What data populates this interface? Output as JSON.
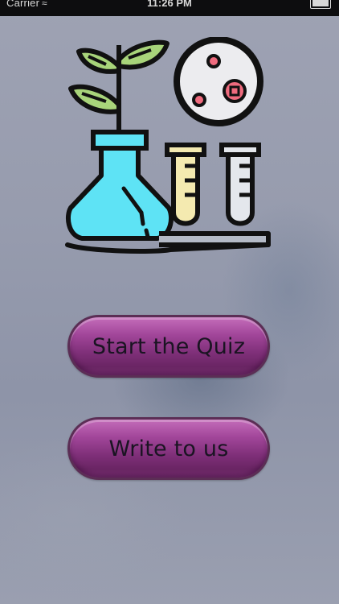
{
  "status_bar": {
    "carrier": "Carrier",
    "time": "11:26 PM"
  },
  "logo": {
    "icon": "science-lab-icon",
    "colors": {
      "flask": "#5ee3f5",
      "leaves": "#a8d47a",
      "tube_left": "#f4eab0",
      "tube_right": "#e4e7ec",
      "dish_spots": "#ef6b7e",
      "outline": "#111111"
    }
  },
  "menu": {
    "start_quiz_label": "Start the Quiz",
    "write_to_us_label": "Write to us"
  },
  "colors": {
    "button_fill": "#8a3683",
    "button_border": "#5b2e55",
    "background": "#979cae"
  }
}
